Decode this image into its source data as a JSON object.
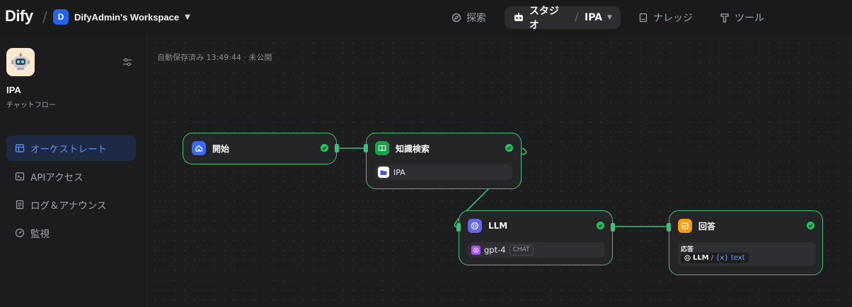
{
  "header": {
    "logo": "Dify",
    "workspace_initial": "D",
    "workspace_name": "DifyAdmin's Workspace",
    "nav": {
      "explore": "探索",
      "studio": "スタジオ",
      "studio_app": "IPA",
      "knowledge": "ナレッジ",
      "tools": "ツール"
    }
  },
  "sidebar": {
    "app_name": "IPA",
    "app_type": "チャットフロー",
    "menu": [
      {
        "label": "オーケストレート",
        "icon": "layout-icon",
        "active": true
      },
      {
        "label": "APIアクセス",
        "icon": "terminal-icon",
        "active": false
      },
      {
        "label": "ログ＆アナウンス",
        "icon": "document-icon",
        "active": false
      },
      {
        "label": "監視",
        "icon": "gauge-icon",
        "active": false
      }
    ]
  },
  "canvas": {
    "autosave": "自動保存済み 13:49:44 · 未公開"
  },
  "nodes": {
    "start": {
      "title": "開始"
    },
    "knowledge": {
      "title": "知識検索",
      "dataset": "IPA"
    },
    "llm": {
      "title": "LLM",
      "model": "gpt-4",
      "mode": "CHAT"
    },
    "answer": {
      "title": "回答",
      "label": "応答",
      "source_node": "LLM",
      "separator": "/",
      "variable": "{x} text"
    }
  },
  "colors": {
    "accent": "#2563eb",
    "node_border": "#3fbf7a",
    "check": "#22c55e",
    "start_icon": "#3b6cf6",
    "knowledge_icon": "#16a34a",
    "llm_icon": "#6366f1",
    "answer_icon": "#f59e0b",
    "active_menu": "#5b8def"
  }
}
